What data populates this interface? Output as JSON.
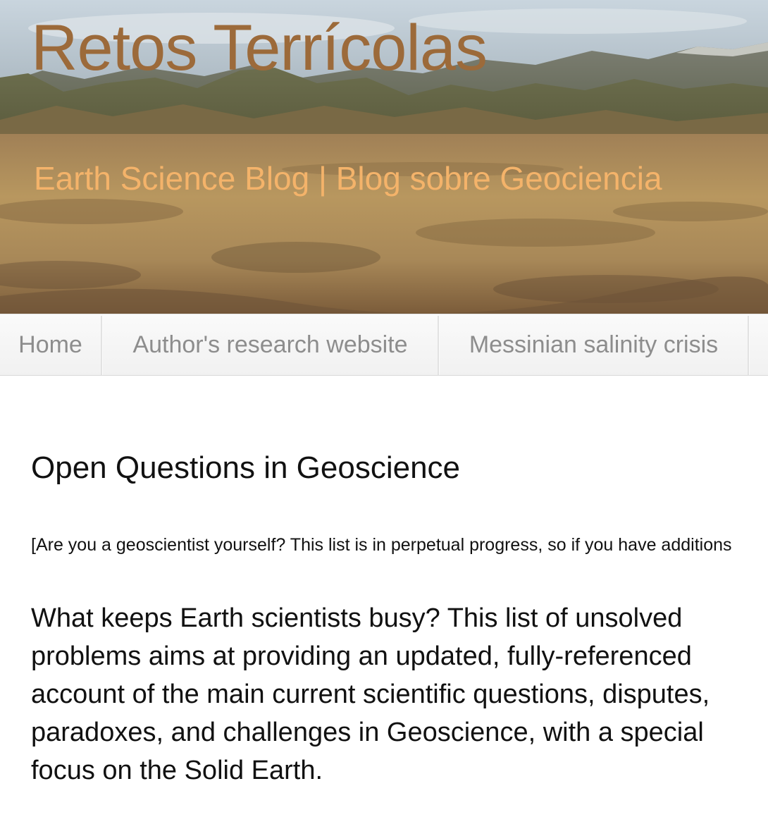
{
  "header": {
    "title": "Retos Terrícolas",
    "subtitle": "Earth Science Blog | Blog sobre Geociencia",
    "title_color": "#9c6a3a",
    "subtitle_color": "#f4b36a"
  },
  "nav": {
    "items": [
      {
        "label": "Home"
      },
      {
        "label": "Author's research website"
      },
      {
        "label": "Messinian salinity crisis"
      }
    ],
    "text_color": "#8d8d8d"
  },
  "post": {
    "title": "Open Questions in Geoscience",
    "note": "[Are you a geoscientist yourself? This list is in perpetual progress, so if you have additions",
    "intro": "What keeps Earth scientists busy? This list of unsolved problems aims at providing an updated, fully-referenced account of the main current scientific questions, disputes, paradoxes, and challenges in Geoscience, with a special focus on the Solid Earth."
  }
}
